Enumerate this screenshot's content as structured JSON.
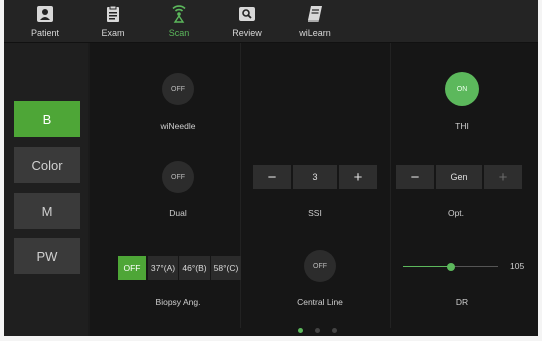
{
  "nav": {
    "items": [
      {
        "label": "Patient",
        "icon": "patient-icon"
      },
      {
        "label": "Exam",
        "icon": "exam-icon"
      },
      {
        "label": "Scan",
        "icon": "scan-icon"
      },
      {
        "label": "Review",
        "icon": "review-icon"
      },
      {
        "label": "wiLearn",
        "icon": "book-icon"
      }
    ],
    "active": "Scan"
  },
  "modes": {
    "items": [
      "B",
      "Color",
      "M",
      "PW"
    ],
    "active": "B"
  },
  "controls": {
    "wineedle": {
      "state": "OFF",
      "label": "wiNeedle"
    },
    "thi": {
      "state": "ON",
      "label": "THI"
    },
    "dual": {
      "state": "OFF",
      "label": "Dual"
    },
    "ssi": {
      "minus": "−",
      "value": "3",
      "plus": "+",
      "label": "SSI"
    },
    "opt": {
      "minus": "−",
      "value": "Gen",
      "plus": "+",
      "label": "Opt."
    },
    "biopsy": {
      "options": [
        "OFF",
        "37°(A)",
        "46°(B)",
        "58°(C)"
      ],
      "selected": "OFF",
      "label": "Biopsy Ang."
    },
    "central_line": {
      "state": "OFF",
      "label": "Central Line"
    },
    "dr": {
      "value": "105",
      "slider_fraction": 0.5,
      "label": "DR"
    }
  },
  "pager": {
    "count": 3,
    "active": 0
  },
  "colors": {
    "accent": "#5cb85c",
    "accent_dark": "#4ea637",
    "panel": "#161616"
  }
}
